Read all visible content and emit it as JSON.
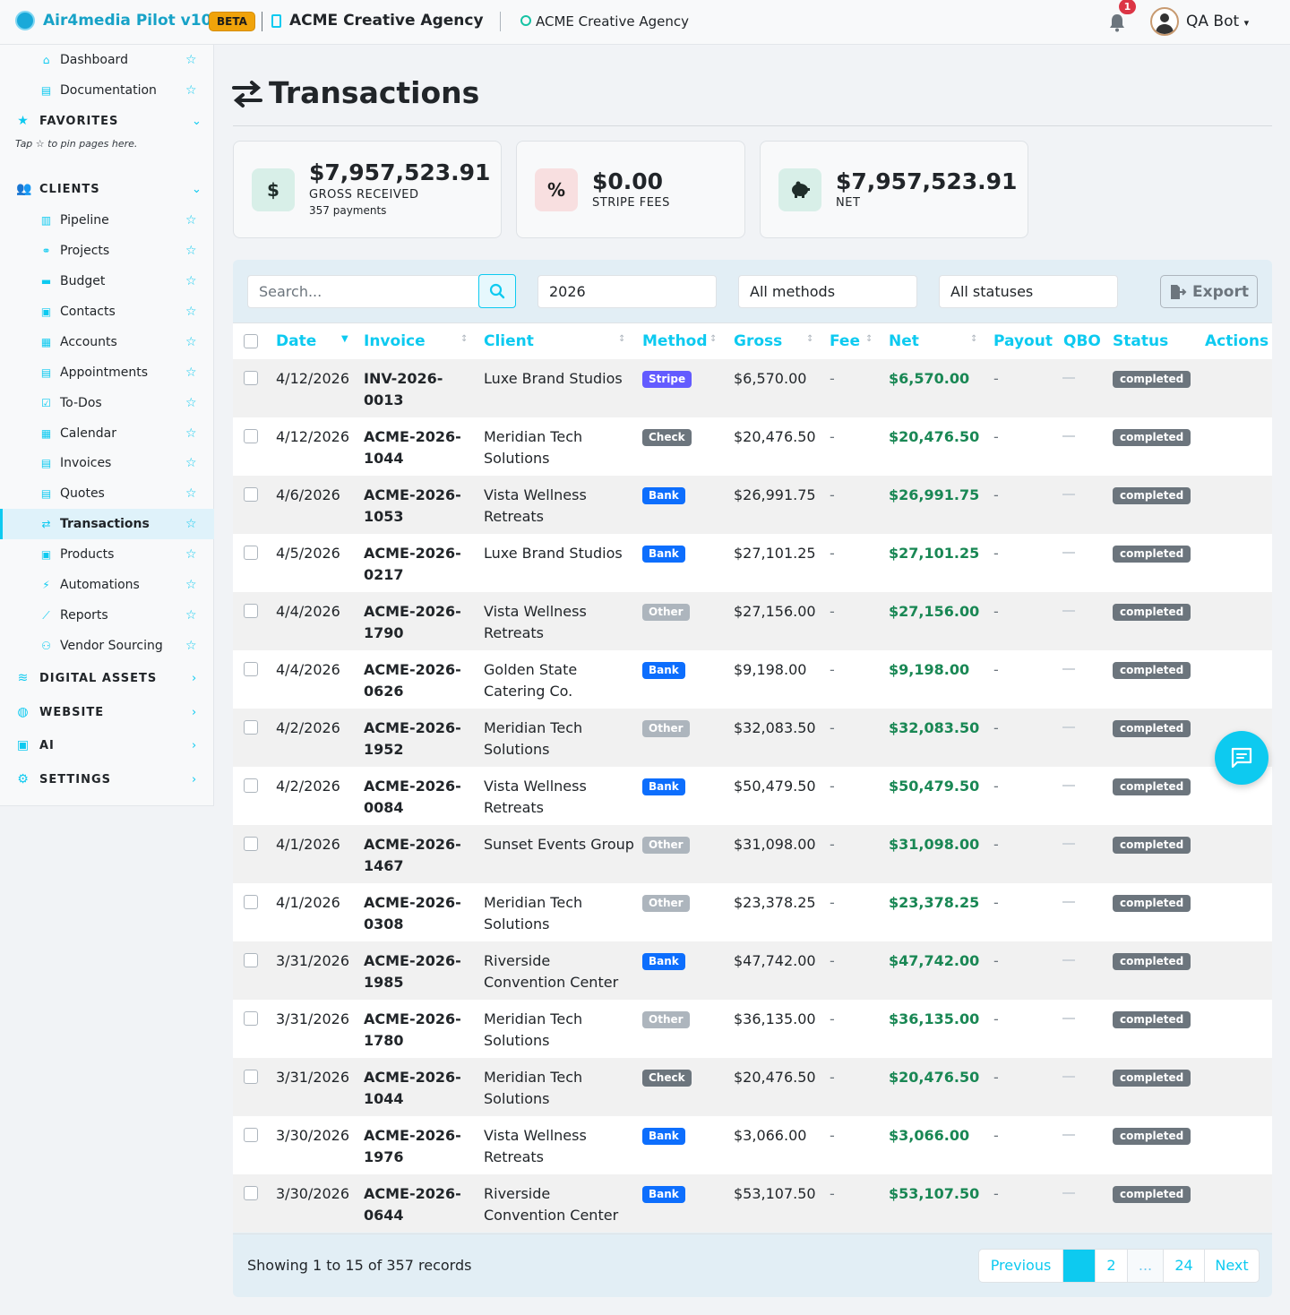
{
  "header": {
    "app_name": "Air4media Pilot v10",
    "beta_label": "BETA",
    "org_name": "ACME Creative Agency",
    "org_switcher": "ACME Creative Agency",
    "notification_count": "1",
    "user_name": "QA Bot"
  },
  "sidebar": {
    "top_items": [
      {
        "label": "Dashboard",
        "icon": "home-icon"
      },
      {
        "label": "Documentation",
        "icon": "book-icon"
      }
    ],
    "favorites_label": "FAVORITES",
    "favorites_hint": "Tap ☆ to pin pages here.",
    "clients_label": "CLIENTS",
    "client_items": [
      {
        "label": "Pipeline",
        "icon": "columns-icon"
      },
      {
        "label": "Projects",
        "icon": "diagram-icon"
      },
      {
        "label": "Budget",
        "icon": "wallet-icon"
      },
      {
        "label": "Contacts",
        "icon": "contact-book-icon"
      },
      {
        "label": "Accounts",
        "icon": "building-icon"
      },
      {
        "label": "Appointments",
        "icon": "calendar-check-icon"
      },
      {
        "label": "To-Dos",
        "icon": "checkbox-icon"
      },
      {
        "label": "Calendar",
        "icon": "calendar-icon"
      },
      {
        "label": "Invoices",
        "icon": "invoice-icon"
      },
      {
        "label": "Quotes",
        "icon": "quote-icon"
      },
      {
        "label": "Transactions",
        "icon": "transfer-icon",
        "active": true
      },
      {
        "label": "Products",
        "icon": "box-icon"
      },
      {
        "label": "Automations",
        "icon": "bolt-icon"
      },
      {
        "label": "Reports",
        "icon": "chart-line-icon"
      },
      {
        "label": "Vendor Sourcing",
        "icon": "people-icon"
      }
    ],
    "sections": [
      {
        "label": "DIGITAL ASSETS",
        "icon": "database-icon"
      },
      {
        "label": "WEBSITE",
        "icon": "globe-icon"
      },
      {
        "label": "AI",
        "icon": "robot-icon"
      },
      {
        "label": "SETTINGS",
        "icon": "gear-icon"
      }
    ]
  },
  "page": {
    "title": "Transactions"
  },
  "summary": {
    "gross": {
      "value": "$7,957,523.91",
      "label": "GROSS RECEIVED",
      "sub": "357 payments",
      "icon_text": "$"
    },
    "fees": {
      "value": "$0.00",
      "label": "STRIPE FEES",
      "icon_text": "%"
    },
    "net": {
      "value": "$7,957,523.91",
      "label": "NET"
    }
  },
  "filters": {
    "search_placeholder": "Search...",
    "year": "2026",
    "methods": "All methods",
    "statuses": "All statuses",
    "export_label": "Export"
  },
  "table": {
    "headers": [
      "Date",
      "Invoice",
      "Client",
      "Method",
      "Gross",
      "Fee",
      "Net",
      "Payout",
      "QBO",
      "Status",
      "Actions"
    ],
    "rows": [
      {
        "date": "4/12/2026",
        "invoice": "INV-2026-0013",
        "client": "Luxe Brand Studios",
        "method": "Stripe",
        "gross": "$6,570.00",
        "fee": "-",
        "net": "$6,570.00",
        "payout": "-",
        "status": "completed"
      },
      {
        "date": "4/12/2026",
        "invoice": "ACME-2026-1044",
        "client": "Meridian Tech Solutions",
        "method": "Check",
        "gross": "$20,476.50",
        "fee": "-",
        "net": "$20,476.50",
        "payout": "-",
        "status": "completed"
      },
      {
        "date": "4/6/2026",
        "invoice": "ACME-2026-1053",
        "client": "Vista Wellness Retreats",
        "method": "Bank",
        "gross": "$26,991.75",
        "fee": "-",
        "net": "$26,991.75",
        "payout": "-",
        "status": "completed"
      },
      {
        "date": "4/5/2026",
        "invoice": "ACME-2026-0217",
        "client": "Luxe Brand Studios",
        "method": "Bank",
        "gross": "$27,101.25",
        "fee": "-",
        "net": "$27,101.25",
        "payout": "-",
        "status": "completed"
      },
      {
        "date": "4/4/2026",
        "invoice": "ACME-2026-1790",
        "client": "Vista Wellness Retreats",
        "method": "Other",
        "gross": "$27,156.00",
        "fee": "-",
        "net": "$27,156.00",
        "payout": "-",
        "status": "completed"
      },
      {
        "date": "4/4/2026",
        "invoice": "ACME-2026-0626",
        "client": "Golden State Catering Co.",
        "method": "Bank",
        "gross": "$9,198.00",
        "fee": "-",
        "net": "$9,198.00",
        "payout": "-",
        "status": "completed"
      },
      {
        "date": "4/2/2026",
        "invoice": "ACME-2026-1952",
        "client": "Meridian Tech Solutions",
        "method": "Other",
        "gross": "$32,083.50",
        "fee": "-",
        "net": "$32,083.50",
        "payout": "-",
        "status": "completed"
      },
      {
        "date": "4/2/2026",
        "invoice": "ACME-2026-0084",
        "client": "Vista Wellness Retreats",
        "method": "Bank",
        "gross": "$50,479.50",
        "fee": "-",
        "net": "$50,479.50",
        "payout": "-",
        "status": "completed"
      },
      {
        "date": "4/1/2026",
        "invoice": "ACME-2026-1467",
        "client": "Sunset Events Group",
        "method": "Other",
        "gross": "$31,098.00",
        "fee": "-",
        "net": "$31,098.00",
        "payout": "-",
        "status": "completed"
      },
      {
        "date": "4/1/2026",
        "invoice": "ACME-2026-0308",
        "client": "Meridian Tech Solutions",
        "method": "Other",
        "gross": "$23,378.25",
        "fee": "-",
        "net": "$23,378.25",
        "payout": "-",
        "status": "completed"
      },
      {
        "date": "3/31/2026",
        "invoice": "ACME-2026-1985",
        "client": "Riverside Convention Center",
        "method": "Bank",
        "gross": "$47,742.00",
        "fee": "-",
        "net": "$47,742.00",
        "payout": "-",
        "status": "completed"
      },
      {
        "date": "3/31/2026",
        "invoice": "ACME-2026-1780",
        "client": "Meridian Tech Solutions",
        "method": "Other",
        "gross": "$36,135.00",
        "fee": "-",
        "net": "$36,135.00",
        "payout": "-",
        "status": "completed"
      },
      {
        "date": "3/31/2026",
        "invoice": "ACME-2026-1044",
        "client": "Meridian Tech Solutions",
        "method": "Check",
        "gross": "$20,476.50",
        "fee": "-",
        "net": "$20,476.50",
        "payout": "-",
        "status": "completed"
      },
      {
        "date": "3/30/2026",
        "invoice": "ACME-2026-1976",
        "client": "Vista Wellness Retreats",
        "method": "Bank",
        "gross": "$3,066.00",
        "fee": "-",
        "net": "$3,066.00",
        "payout": "-",
        "status": "completed"
      },
      {
        "date": "3/30/2026",
        "invoice": "ACME-2026-0644",
        "client": "Riverside Convention Center",
        "method": "Bank",
        "gross": "$53,107.50",
        "fee": "-",
        "net": "$53,107.50",
        "payout": "-",
        "status": "completed"
      }
    ]
  },
  "method_colors": {
    "Stripe": "#635bff",
    "Check": "#6c757d",
    "Bank": "#0d6efd",
    "Other": "#adb5bd"
  },
  "pagination": {
    "summary": "Showing 1 to 15 of 357 records",
    "previous": "Previous",
    "pages": [
      "",
      "2",
      "...",
      "24"
    ],
    "next": "Next"
  }
}
